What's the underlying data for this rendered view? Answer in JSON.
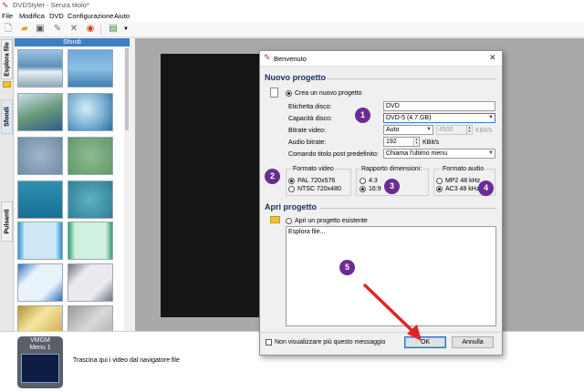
{
  "window": {
    "title": "DVDStyler - Senza titolo*",
    "icon": "dvdstyler-icon"
  },
  "menubar": [
    "File",
    "Modifica",
    "DVD",
    "Configurazione",
    "Aiuto"
  ],
  "toolbar": {
    "icons": [
      "new-document-icon",
      "open-folder-icon",
      "save-icon",
      "edit-icon",
      "settings-icon",
      "burn-disc-icon",
      "add-export-icon"
    ]
  },
  "side_tabs": [
    "Esplora file",
    "Sfondi",
    "Pulsanti"
  ],
  "backgrounds_panel": {
    "header": "Sfondi"
  },
  "bottom": {
    "vmgm_label": "VMGM",
    "menu_label": "Menu 1",
    "drag_hint": "Trascina qui i video dal navigatore file"
  },
  "dialog": {
    "title": "Benvenuto",
    "new_project": {
      "heading": "Nuovo progetto",
      "create_option": "Crea un nuovo progetto",
      "disc_label": {
        "label": "Etichetta disco:",
        "value": "DVD"
      },
      "disc_capacity": {
        "label": "Capacità disco:",
        "value": "DVD-5 (4.7 GB)"
      },
      "video_bitrate": {
        "label": "Bitrate video:",
        "mode": "Auto",
        "value": "4500",
        "unit": "KBit/s"
      },
      "audio_bitrate": {
        "label": "Audio bitrate:",
        "value": "192",
        "unit": "KBit/s"
      },
      "post_command": {
        "label": "Comando titolo post predefinito:",
        "value": "Chiama l'ultimo menu"
      },
      "video_format": {
        "title": "Formato video",
        "options": [
          "PAL 720x576",
          "NTSC 720x480"
        ],
        "selected": "PAL 720x576"
      },
      "aspect_ratio": {
        "title": "Rapporto dimensioni:",
        "options": [
          "4:3",
          "16:9"
        ],
        "selected": "16:9"
      },
      "audio_format": {
        "title": "Formato audio",
        "options": [
          "MP2 48 kHz",
          "AC3 48 kHz"
        ],
        "selected": "AC3 48 kHz"
      }
    },
    "open_project": {
      "heading": "Apri progetto",
      "open_option": "Apri un progetto esistente",
      "file_list_item": "Esplora file..."
    },
    "dont_show_label": "Non visualizzare più questo messaggio",
    "ok_label": "OK",
    "cancel_label": "Annulla"
  },
  "annotations": [
    "1",
    "2",
    "3",
    "4",
    "5"
  ],
  "colors": {
    "accent": "#3b80c7",
    "badge": "#6a2c91",
    "arrow": "#e02424",
    "preview_bg": "#a9a9a9"
  }
}
